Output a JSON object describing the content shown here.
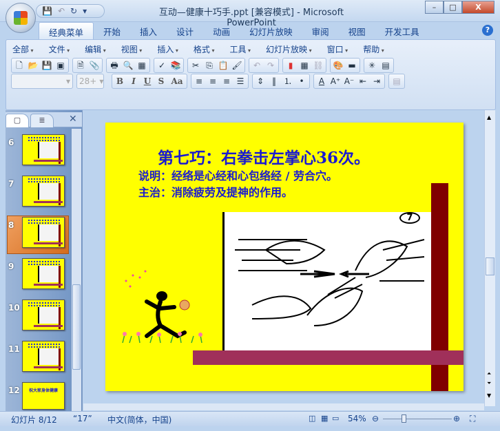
{
  "window": {
    "title": "互动—健康十巧手.ppt [兼容模式] - Microsoft PowerPoint",
    "minimize": "–",
    "maximize": "□",
    "close": "X"
  },
  "qat": {
    "save": "💾",
    "undo": "↶",
    "redo": "↻",
    "more": "▾"
  },
  "tabs": [
    "经典菜单",
    "开始",
    "插入",
    "设计",
    "动画",
    "幻灯片放映",
    "审阅",
    "视图",
    "开发工具"
  ],
  "help": "?",
  "menus": [
    "全部",
    "文件",
    "编辑",
    "视图",
    "插入",
    "格式",
    "工具",
    "幻灯片放映",
    "窗口",
    "帮助"
  ],
  "toolbar": {
    "font_name": "",
    "font_size": "28+",
    "bold": "B",
    "italic": "I",
    "underline": "U",
    "shadow": "S",
    "change_case": "Aa"
  },
  "panel": {
    "tab_slides": "▢",
    "tab_outline": "≣",
    "close": "✕",
    "thumbnails": [
      {
        "num": "6"
      },
      {
        "num": "7"
      },
      {
        "num": "8"
      },
      {
        "num": "9"
      },
      {
        "num": "10"
      },
      {
        "num": "11"
      },
      {
        "num": "12",
        "title": "祝大家身体健康"
      }
    ],
    "selected": "8"
  },
  "slide": {
    "title": "第七巧：右拳击左掌心36次。",
    "line1": "说明：经络是心经和心包络经 / 劳合穴。",
    "line2": "主治：消除疲劳及提神的作用。",
    "badge": "7",
    "colors": {
      "background": "#ffff00",
      "text": "#1a1ad0",
      "vertical_bar": "#800000",
      "horizontal_bar": "#a0305a"
    }
  },
  "status": {
    "slide": "幻灯片 8/12",
    "theme": "“17”",
    "language": "中文(简体，中国)",
    "zoom": "54%",
    "zoom_level_percent": 54
  }
}
